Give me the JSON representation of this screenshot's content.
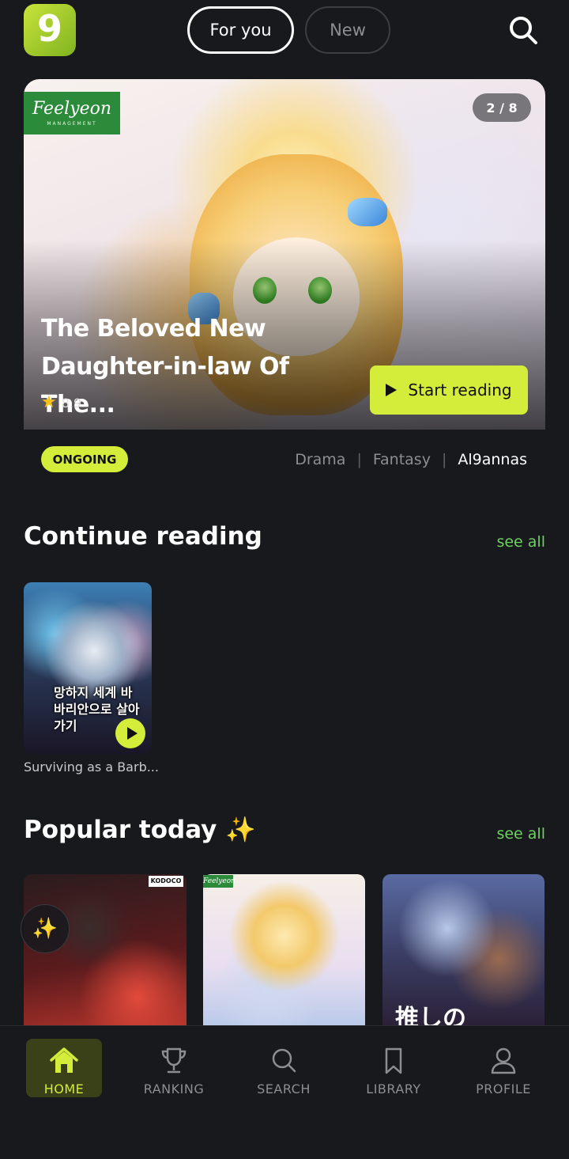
{
  "header": {
    "logo_glyph": "9",
    "tabs": [
      {
        "label": "For you",
        "active": true
      },
      {
        "label": "New",
        "active": false
      }
    ],
    "search_icon": "search-icon"
  },
  "hero": {
    "publisher_logo": "Feelyeon",
    "publisher_logo_sub": "MANAGEMENT",
    "page_indicator": "2 / 8",
    "title": "The Beloved New Daughter-in-law Of The...",
    "rating": "8.9",
    "cta_label": "Start reading",
    "status": "ONGOING",
    "genres": [
      "Drama",
      "Fantasy"
    ],
    "author": "Al9annas",
    "separator": "|"
  },
  "continue_reading": {
    "title": "Continue reading",
    "see_all": "see all",
    "items": [
      {
        "caption": "Surviving as a Barb...",
        "cover_text": "망하지 세계 바바리안으로 살아가기"
      }
    ]
  },
  "popular_today": {
    "title": "Popular today",
    "emoji": "✨",
    "see_all": "see all",
    "items": [
      {
        "badge": "KODOCO"
      },
      {
        "badge": "Feelyeon"
      },
      {
        "badge": "推しの"
      }
    ]
  },
  "bottom_nav": {
    "items": [
      {
        "label": "HOME",
        "icon": "home-icon",
        "active": true
      },
      {
        "label": "RANKING",
        "icon": "trophy-icon",
        "active": false
      },
      {
        "label": "SEARCH",
        "icon": "search-icon",
        "active": false
      },
      {
        "label": "LIBRARY",
        "icon": "bookmark-icon",
        "active": false
      },
      {
        "label": "PROFILE",
        "icon": "user-icon",
        "active": false
      }
    ]
  },
  "colors": {
    "background": "#18191d",
    "accent": "#d4ec3a",
    "see_all": "#6fcf62",
    "muted": "#8c8e93"
  }
}
